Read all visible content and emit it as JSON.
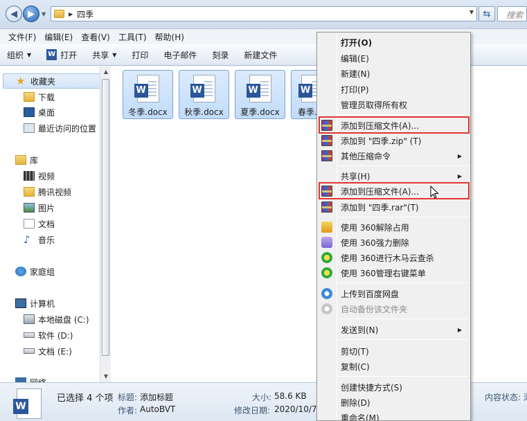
{
  "address": {
    "path_segment": "四季",
    "search_placeholder": "搜索"
  },
  "menubar": [
    "文件(F)",
    "编辑(E)",
    "查看(V)",
    "工具(T)",
    "帮助(H)"
  ],
  "toolbar": {
    "organize": "组织",
    "open": "打开",
    "share": "共享",
    "print": "打印",
    "email": "电子邮件",
    "burn": "刻录",
    "newfolder": "新建文件"
  },
  "sidebar": {
    "favorites": "收藏夹",
    "downloads": "下载",
    "desktop": "桌面",
    "recent": "最近访问的位置",
    "libraries": "库",
    "videos": "视频",
    "tencent": "腾讯视频",
    "pictures": "图片",
    "documents": "文档",
    "music": "音乐",
    "homegroup": "家庭组",
    "computer": "计算机",
    "drive_c": "本地磁盘 (C:)",
    "drive_d": "软件 (D:)",
    "drive_e": "文档 (E:)",
    "network": "网络"
  },
  "files": [
    "冬季.docx",
    "秋季.docx",
    "夏季.docx",
    "春季.docx"
  ],
  "status": {
    "selected": "已选择 4 个项",
    "title_label": "标题:",
    "title_value": "添加标题",
    "author_label": "作者:",
    "author_value": "AutoBVT",
    "size_label": "大小:",
    "size_value": "58.6 KB",
    "modified_label": "修改日期:",
    "modified_value": "2020/10/7",
    "content_status": "内容状态: 添"
  },
  "context_menu": {
    "open": "打开(O)",
    "edit": "编辑(E)",
    "new": "新建(N)",
    "print": "打印(P)",
    "take_ownership": "管理员取得所有权",
    "add_archive_1": "添加到压缩文件(A)...",
    "add_zip": "添加到 \"四季.zip\" (T)",
    "other_compress": "其他压缩命令",
    "share": "共享(H)",
    "add_archive_2": "添加到压缩文件(A)...",
    "add_rar": "添加到 \"四季.rar\"(T)",
    "unlock_360": "使用 360解除占用",
    "delete_360": "使用 360强力删除",
    "scan_360": "使用 360进行木马云查杀",
    "manage_360": "使用 360管理右键菜单",
    "upload_baidu": "上传到百度网盘",
    "auto_backup": "自动备份该文件夹",
    "send_to": "发送到(N)",
    "cut": "剪切(T)",
    "copy": "复制(C)",
    "shortcut": "创建快捷方式(S)",
    "delete": "删除(D)",
    "rename": "重命名(M)"
  }
}
